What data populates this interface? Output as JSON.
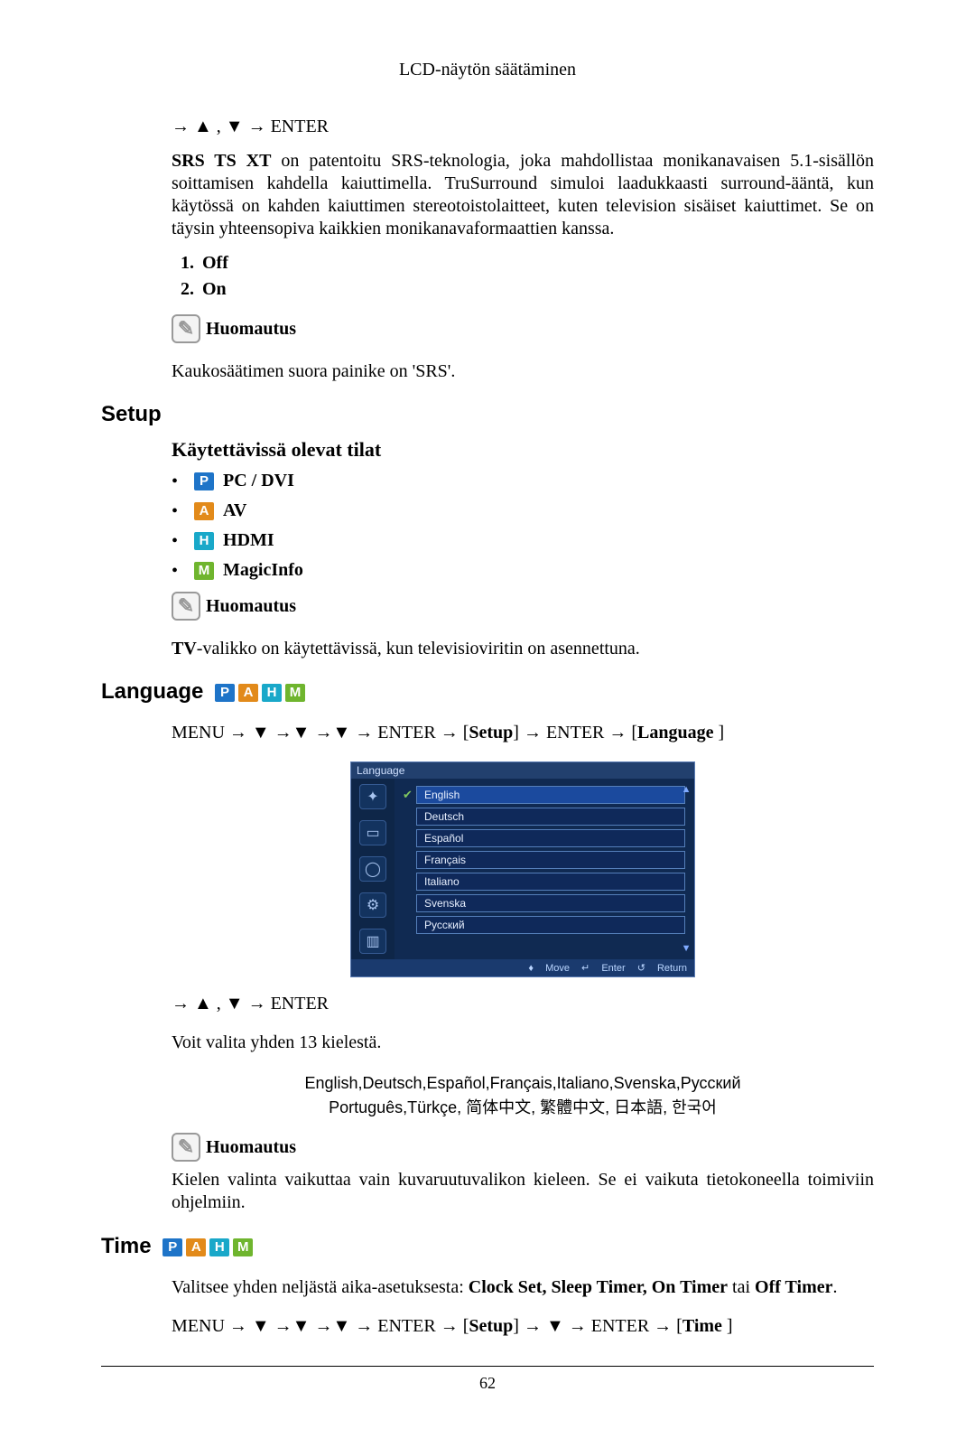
{
  "header": "LCD-näytön säätäminen",
  "srs": {
    "nav": "→ ▲ , ▼ → ENTER",
    "lead_bold": "SRS TS XT",
    "lead_rest": " on patentoitu SRS-teknologia, joka mahdollistaa monikanavaisen 5.1-sisällön soittamisen kahdella kaiuttimella. TruSurround simuloi laadukkaasti surround-ääntä, kun käytössä on kahden kaiuttimen stereotoistolaitteet, kuten television sisäiset kaiuttimet. Se on täysin yhteensopiva kaikkien monikanavaformaattien kanssa.",
    "opt1": "Off",
    "opt2": "On",
    "note_label": "Huomautus",
    "note_text": "Kaukosäätimen suora painike on 'SRS'."
  },
  "setup": {
    "title": "Setup",
    "subtitle": "Käytettävissä olevat tilat",
    "modes": {
      "p": "PC / DVI",
      "a": "AV",
      "h": "HDMI",
      "m": "MagicInfo"
    },
    "note_label": "Huomautus",
    "note_lead_bold": "TV",
    "note_rest": "-valikko on käytettävissä, kun televisioviritin on asennettuna."
  },
  "language": {
    "title": "Language",
    "path_pre": "MENU → ▼ →▼ →▼ → ENTER → [",
    "path_setup": "Setup",
    "path_mid": "] → ENTER → [",
    "path_lang": "Language",
    "path_post": " ]",
    "osd": {
      "title": "Language",
      "items": [
        "English",
        "Deutsch",
        "Español",
        "Français",
        "Italiano",
        "Svenska",
        "Русский"
      ],
      "footer_move": "Move",
      "footer_enter": "Enter",
      "footer_return": "Return"
    },
    "nav2": "→ ▲ , ▼ → ENTER",
    "choose": "Voit valita yhden 13 kielestä.",
    "languages_line1": "English,Deutsch,Español,Français,Italiano,Svenska,Русский",
    "languages_line2": "Português,Türkçe, 简体中文,  繁體中文, 日本語, 한국어",
    "note_label": "Huomautus",
    "note_text": "Kielen valinta vaikuttaa vain kuvaruutuvalikon kieleen. Se ei vaikuta tietokoneella toimiviin ohjelmiin."
  },
  "time": {
    "title": "Time",
    "desc_pre": "Valitsee yhden neljästä aika-asetuksesta: ",
    "desc_items": "Clock Set, Sleep Timer, On Timer",
    "desc_or": " tai ",
    "desc_last": "Off Timer",
    "desc_end": ".",
    "path_pre": "MENU → ▼ →▼ →▼ → ENTER → [",
    "path_setup": "Setup",
    "path_mid": "] → ▼ → ENTER → [",
    "path_time": "Time",
    "path_post": " ]"
  },
  "page_number": "62"
}
